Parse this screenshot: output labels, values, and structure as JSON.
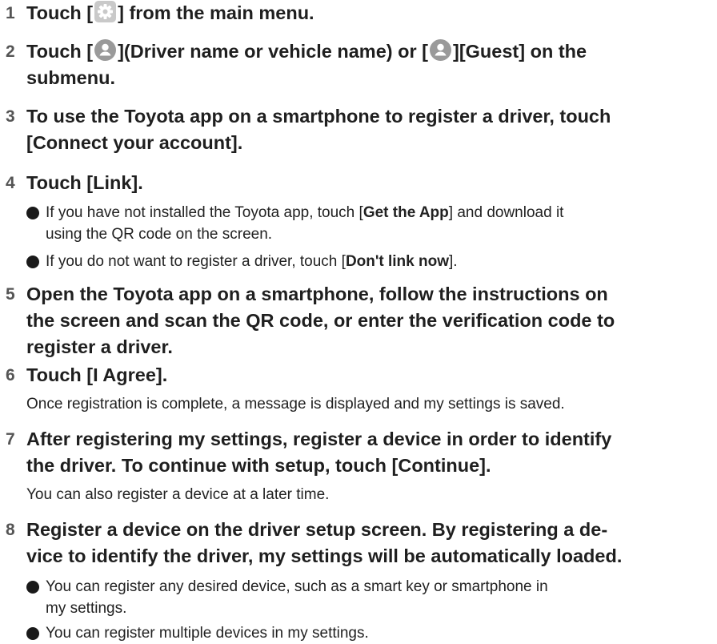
{
  "steps": [
    {
      "num": "1",
      "pre": "Touch [",
      "icon": "gear-icon",
      "post": "] from the main menu."
    },
    {
      "num": "2",
      "l1a": "Touch [",
      "icon1": "person-icon",
      "l1b": "](Driver name or vehicle name) or [",
      "icon2": "person-icon",
      "l1c": "][Guest] on the",
      "l2": "submenu."
    },
    {
      "num": "3",
      "l1": "To use the Toyota app on a smartphone to register a driver, touch",
      "l2": "[Connect your account]."
    },
    {
      "num": "4",
      "title": "Touch [Link].",
      "b1": {
        "l1a": "If you have not installed the Toyota app, touch [",
        "bold": "Get the App",
        "l1b": "] and download it",
        "l2": "using the QR code on the screen."
      },
      "b2": {
        "pre": "If you do not want to register a driver, touch [",
        "bold": "Don't link now",
        "post": "]."
      }
    },
    {
      "num": "5",
      "l1": "Open the Toyota app on a smartphone, follow the instructions on",
      "l2": "the screen and scan the QR code, or enter the verification code to",
      "l3": "register a driver."
    },
    {
      "num": "6",
      "title": "Touch [I Agree].",
      "note": "Once registration is complete, a message is displayed and my settings is saved."
    },
    {
      "num": "7",
      "l1": "After registering my settings, register a device in order to identify",
      "l2": "the driver. To continue with setup, touch [Continue].",
      "note": "You can also register a device at a later time."
    },
    {
      "num": "8",
      "l1": "Register a device on the driver setup screen. By registering a de-",
      "l2": "vice to identify the driver, my settings will be automatically loaded.",
      "b1": {
        "l1": "You can register any desired device, such as a smart key or smartphone in",
        "l2": "my settings."
      },
      "b2": {
        "text": "You can register multiple devices in my settings."
      }
    }
  ]
}
